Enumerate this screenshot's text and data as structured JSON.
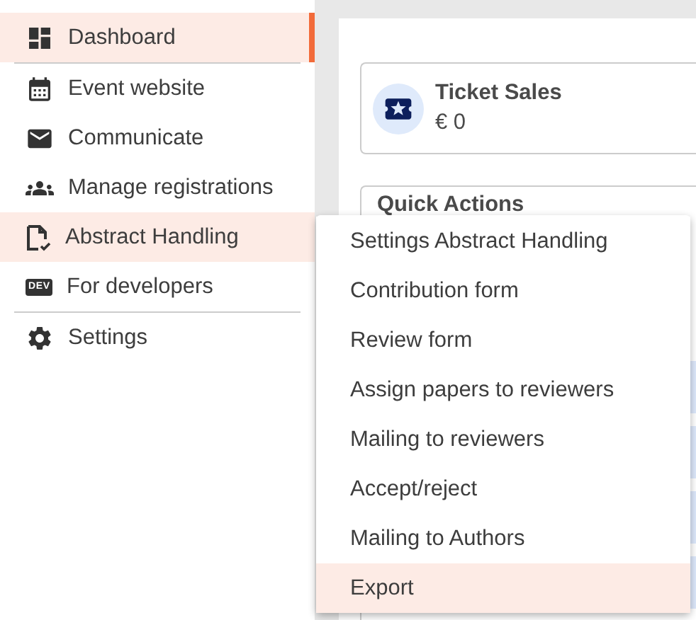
{
  "sidebar": {
    "items": [
      {
        "label": "Dashboard",
        "selected": true,
        "highlighted": false
      },
      {
        "label": "Event website",
        "selected": false,
        "highlighted": false
      },
      {
        "label": "Communicate",
        "selected": false,
        "highlighted": false
      },
      {
        "label": "Manage registrations",
        "selected": false,
        "highlighted": false
      },
      {
        "label": "Abstract Handling",
        "selected": false,
        "highlighted": true
      },
      {
        "label": "For developers",
        "selected": false,
        "highlighted": false,
        "icon_text": "DEV"
      },
      {
        "label": "Settings",
        "selected": false,
        "highlighted": false
      }
    ]
  },
  "stats_card": {
    "title": "Ticket Sales",
    "value": "€ 0"
  },
  "quick_actions": {
    "title": "Quick Actions"
  },
  "menu": {
    "items": [
      {
        "label": "Settings Abstract Handling",
        "highlighted": false
      },
      {
        "label": "Contribution form",
        "highlighted": false
      },
      {
        "label": "Review form",
        "highlighted": false
      },
      {
        "label": "Assign papers to reviewers",
        "highlighted": false
      },
      {
        "label": "Mailing to reviewers",
        "highlighted": false
      },
      {
        "label": "Accept/reject",
        "highlighted": false
      },
      {
        "label": "Mailing to Authors",
        "highlighted": false
      },
      {
        "label": "Export",
        "highlighted": true
      }
    ]
  }
}
